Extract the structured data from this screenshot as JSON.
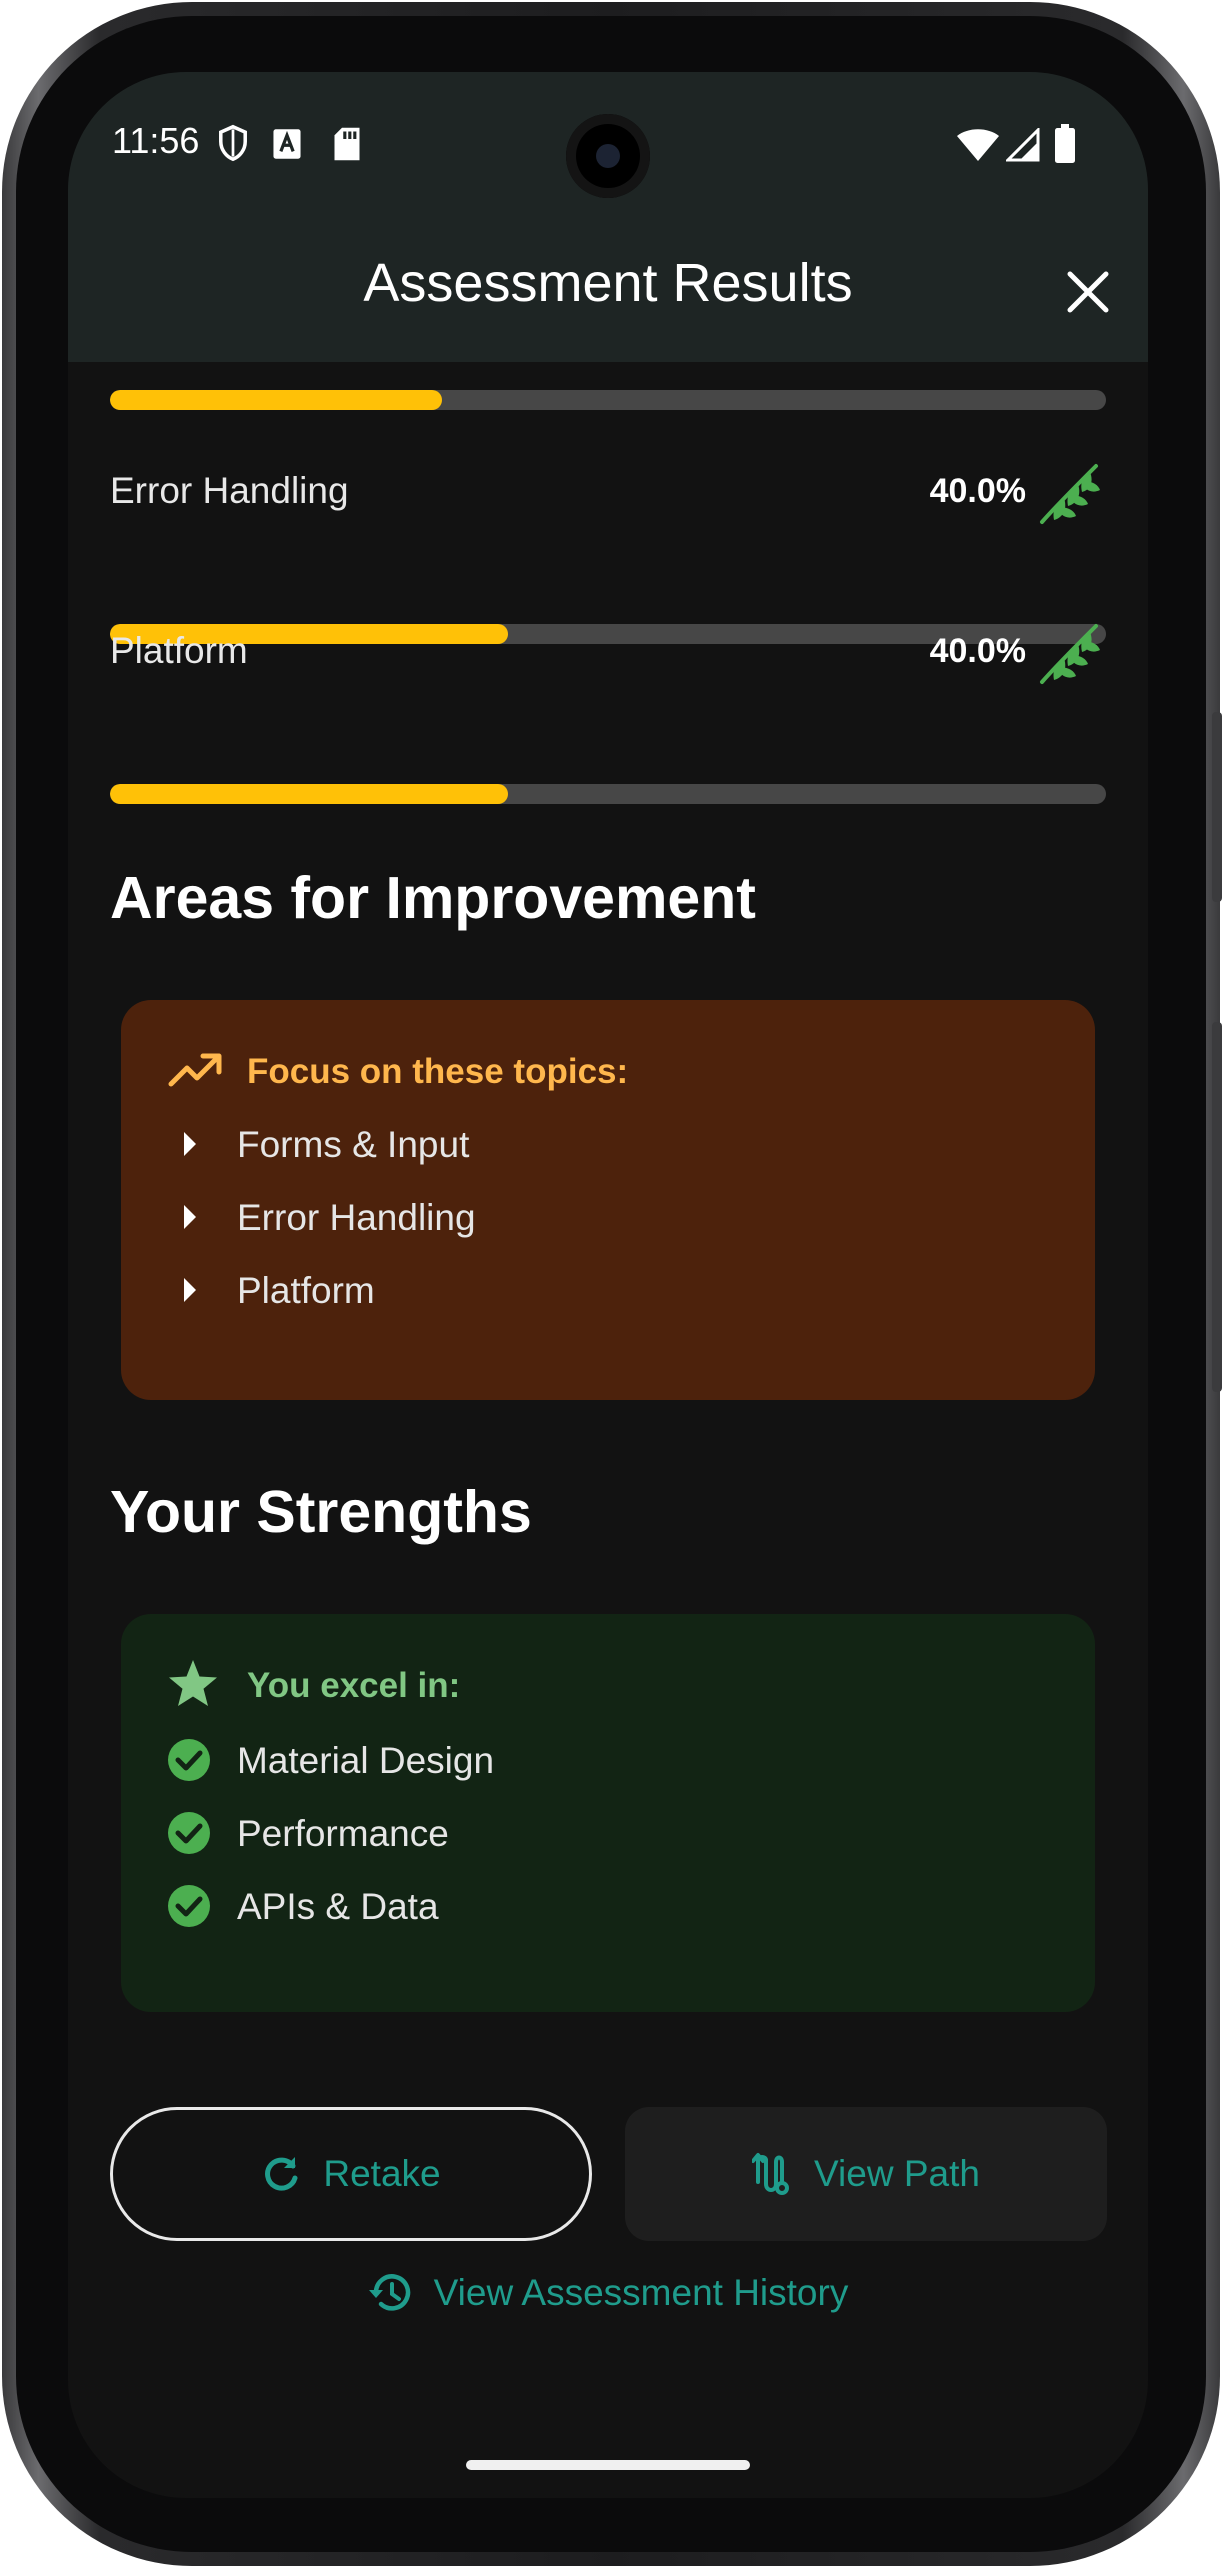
{
  "status": {
    "time": "11:56"
  },
  "app_bar": {
    "title": "Assessment Results"
  },
  "scores": [
    {
      "label": "",
      "percent": 33.3,
      "value_text": ""
    },
    {
      "label": "Error Handling",
      "percent": 40.0,
      "value_text": "40.0%"
    },
    {
      "label": "Platform",
      "percent": 40.0,
      "value_text": "40.0%"
    }
  ],
  "improvement": {
    "section_title": "Areas for Improvement",
    "heading": "Focus on these topics:",
    "items": [
      "Forms & Input",
      "Error Handling",
      "Platform"
    ]
  },
  "strengths": {
    "section_title": "Your Strengths",
    "heading": "You excel in:",
    "items": [
      "Material Design",
      "Performance",
      "APIs & Data"
    ]
  },
  "actions": {
    "retake_label": "Retake",
    "view_path_label": "View Path",
    "history_label": "View Assessment History"
  },
  "colors": {
    "accent": "#1f9c8c",
    "progress": "#ffc107",
    "improve_card": "#4d220c",
    "improve_text": "#ffb74d",
    "strength_card": "#122414",
    "strength_text": "#81c784",
    "check": "#4caf50"
  },
  "icons": {
    "shield": "shield-icon",
    "sim": "sd-card-icon",
    "wifi": "wifi-icon",
    "signal": "signal-icon",
    "battery": "battery-icon",
    "close": "close-icon",
    "leaf": "leaf-icon",
    "trend": "trending-up-icon",
    "arrow": "arrow-right-icon",
    "star": "star-icon",
    "check": "check-circle-icon",
    "refresh": "refresh-icon",
    "path": "route-icon",
    "history": "history-icon"
  }
}
